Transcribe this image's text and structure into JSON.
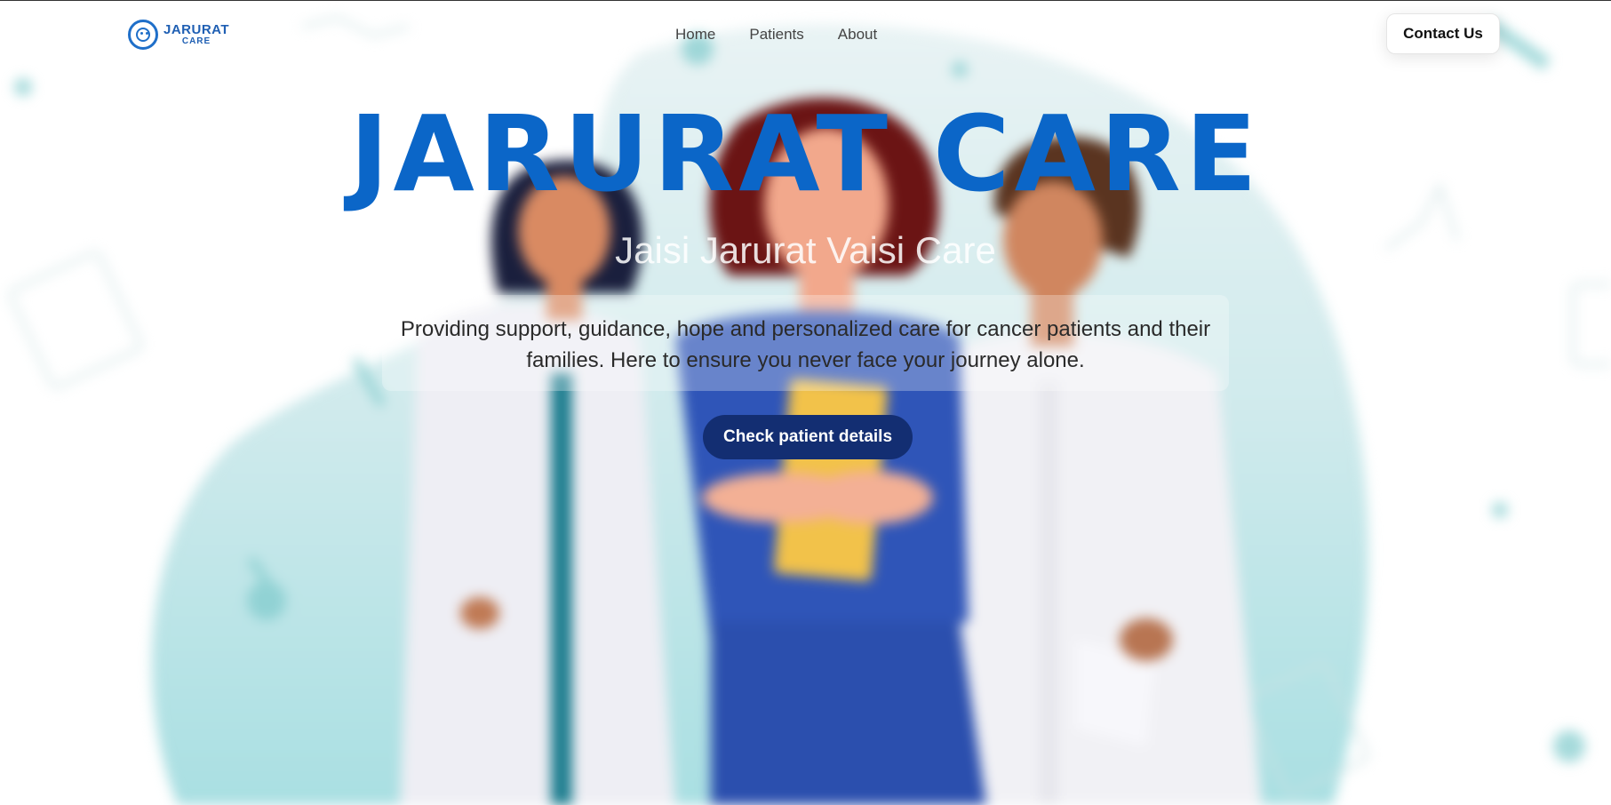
{
  "brand": {
    "logo_line1": "JARURAT",
    "logo_line2": "CARE",
    "accent_color": "#0b66c8",
    "button_color": "#132e72"
  },
  "nav": {
    "links": [
      {
        "label": "Home"
      },
      {
        "label": "Patients"
      },
      {
        "label": "About"
      }
    ],
    "contact_label": "Contact Us"
  },
  "hero": {
    "title": "JARURAT CARE",
    "tagline": "Jaisi Jarurat Vaisi Care",
    "description": "Providing support, guidance, hope and personalized care for cancer patients and their families. Here to ensure you never face your journey alone.",
    "cta_label": "Check patient details"
  },
  "background": {
    "illustration": "three-healthcare-workers-icon"
  }
}
